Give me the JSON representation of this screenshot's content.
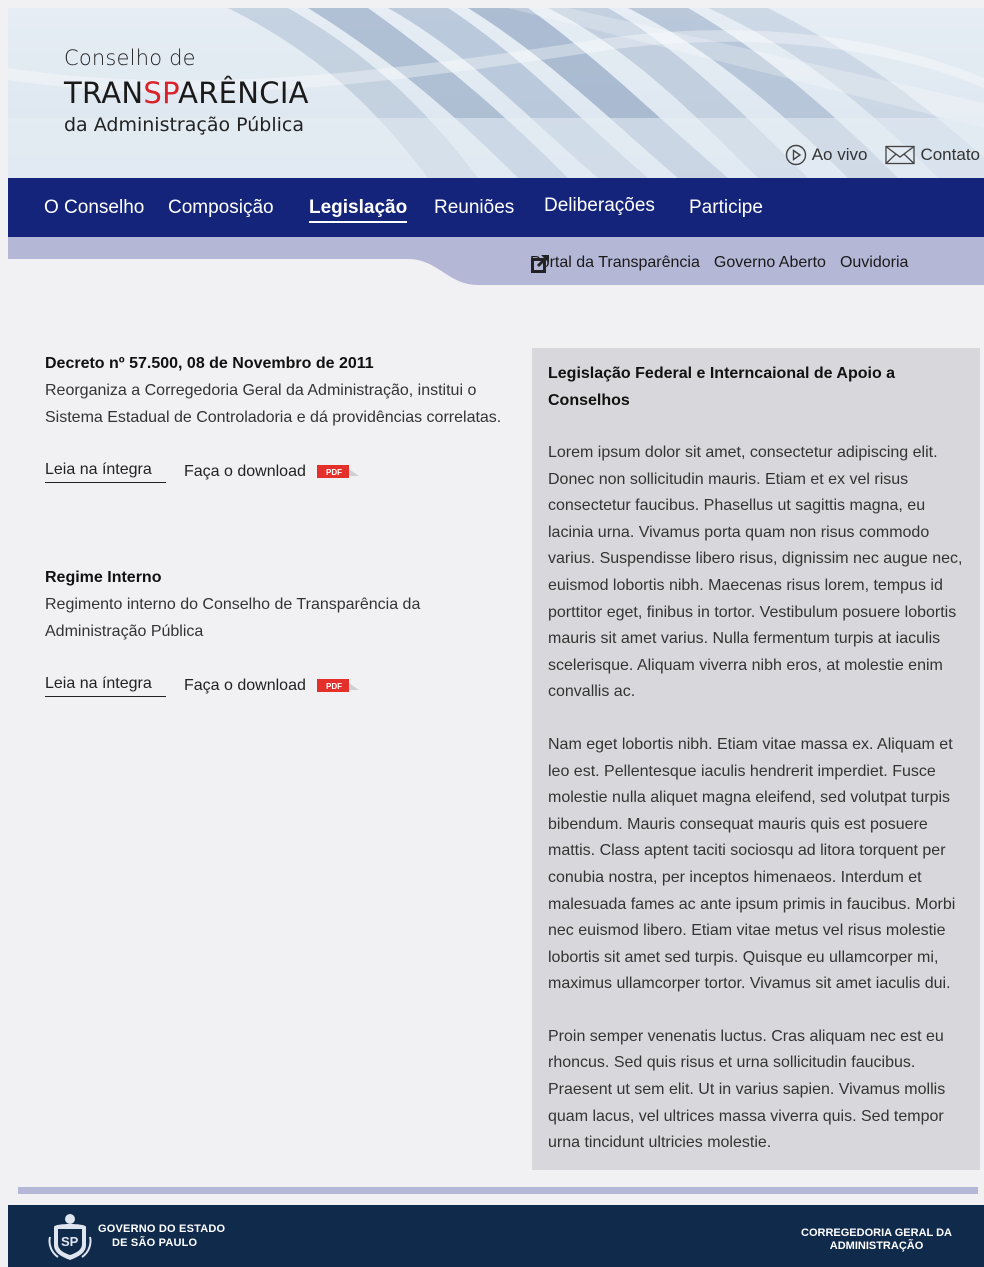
{
  "header": {
    "logo_line1": "Conselho de",
    "logo_line2_a": "TRAN",
    "logo_line2_b": "SP",
    "logo_line2_c": "ARÊNCIA",
    "logo_line3": "da Administração Pública",
    "links": [
      {
        "label": "Ao vivo",
        "icon": "play-circle-icon"
      },
      {
        "label": "Contato",
        "icon": "envelope-icon"
      }
    ]
  },
  "nav": {
    "items": [
      {
        "label": "O Conselho",
        "active": false
      },
      {
        "label": "Composição",
        "active": false
      },
      {
        "label": "Legislação",
        "active": true
      },
      {
        "label": "Reuniões",
        "active": false
      },
      {
        "label": "Deliberações",
        "active": false
      },
      {
        "label": "Participe",
        "active": false
      }
    ]
  },
  "subnav": {
    "icon": "external-link-icon",
    "links": [
      "Portal da Transparência",
      "Governo Aberto",
      "Ouvidoria"
    ]
  },
  "documents": [
    {
      "title": "Decreto nº 57.500, 08 de Novembro de 2011",
      "description": "Reorganiza a Corregedoria Geral da Administração, institui o Sistema Estadual de Controladoria e dá providências correlatas.",
      "read_label": "Leia na íntegra",
      "download_label": "Faça o download",
      "file_badge": "PDF"
    },
    {
      "title": "Regime Interno",
      "description": "Regimento interno do Conselho de Transparência da Administração Pública",
      "read_label": "Leia na íntegra",
      "download_label": "Faça o download",
      "file_badge": "PDF"
    }
  ],
  "panel": {
    "title": "Legislação Federal e Interncaional de Apoio a Conselhos",
    "paragraphs": [
      "Lorem ipsum dolor sit amet, consectetur adipiscing elit. Donec non sollicitudin mauris. Etiam et ex vel risus consectetur faucibus. Phasellus ut sagittis magna, eu lacinia urna. Vivamus porta quam non risus commodo varius. Suspendisse libero risus, dignissim nec augue nec, euismod lobortis nibh. Maecenas risus lorem, tempus id porttitor eget, finibus in tortor. Vestibulum posuere lobortis mauris sit amet varius. Nulla fermentum turpis at iaculis scelerisque. Aliquam viverra nibh eros, at molestie enim convallis ac.",
      "Nam eget lobortis nibh. Etiam vitae massa ex. Aliquam et leo est. Pellentesque iaculis hendrerit imperdiet. Fusce molestie nulla aliquet magna eleifend, sed volutpat turpis bibendum. Mauris consequat mauris quis est posuere mattis. Class aptent taciti sociosqu ad litora torquent per conubia nostra, per inceptos himenaeos. Interdum et malesuada fames ac ante ipsum primis in faucibus. Morbi nec euismod libero. Etiam vitae metus vel risus molestie lobortis sit amet sed turpis. Quisque eu ullamcorper mi, maximus ullamcorper tortor. Vivamus sit amet iaculis dui.",
      "Proin semper venenatis luctus. Cras aliquam nec est eu rhoncus. Sed quis risus et urna sollicitudin faucibus. Praesent ut sem elit. Ut in varius sapien. Vivamus mollis quam lacus, vel ultrices massa viverra quis. Sed tempor urna tincidunt ultricies molestie."
    ]
  },
  "footer": {
    "gov_line1": "GOVERNO DO ESTADO",
    "gov_line2": "DE SÃO PAULO",
    "seal_text": "SP",
    "corr_line1": "CORREGEDORIA GERAL DA",
    "corr_line2": "ADMINISTRAÇÃO"
  },
  "colors": {
    "nav_bg": "#14247a",
    "accent_red": "#d8232a",
    "panel_bg": "#d8d8dc",
    "footer_bg": "#102a4c",
    "subbar_bg": "#b4b7d6"
  }
}
